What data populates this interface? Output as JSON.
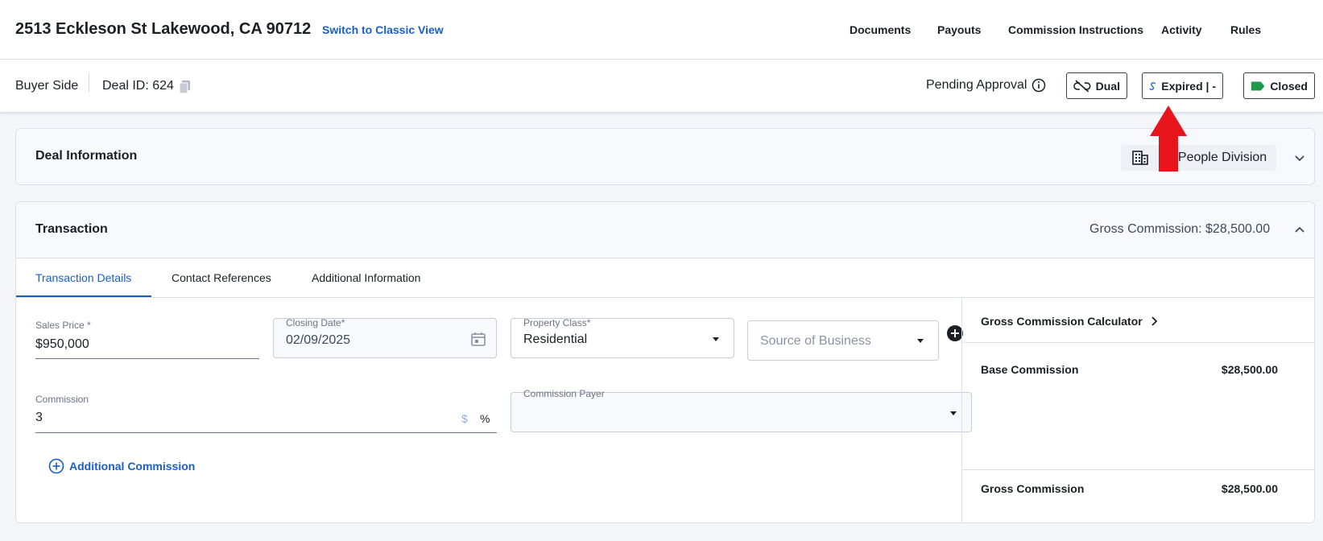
{
  "header": {
    "title": "2513 Eckleson St Lakewood, CA 90712",
    "classic_link": "Switch to Classic View",
    "nav": [
      "Documents",
      "Payouts",
      "Commission Instructions",
      "Activity",
      "Rules"
    ]
  },
  "subheader": {
    "side": "Buyer Side",
    "deal_id": "Deal ID: 624",
    "status": "Pending Approval",
    "chips": {
      "dual": "Dual",
      "expired": "Expired | -",
      "closed": "Closed"
    }
  },
  "deal_info": {
    "title": "Deal Information",
    "division": "No People Division"
  },
  "transaction": {
    "title": "Transaction",
    "gross_header": "Gross Commission: $28,500.00",
    "tabs": [
      "Transaction Details",
      "Contact References",
      "Additional Information"
    ],
    "fields": {
      "sales_price_label": "Sales Price *",
      "sales_price": "$950,000",
      "closing_date_label": "Closing Date*",
      "closing_date": "02/09/2025",
      "property_class_label": "Property Class*",
      "property_class": "Residential",
      "source_placeholder": "Source of Business",
      "commission_label": "Commission",
      "commission": "3",
      "dollar": "$",
      "percent": "%",
      "payer_label": "Commission Payer"
    },
    "additional_commission": "Additional Commission",
    "calculator": {
      "title": "Gross Commission Calculator",
      "base_label": "Base Commission",
      "base_value": "$28,500.00",
      "gross_label": "Gross Commission",
      "gross_value": "$28,500.00"
    }
  },
  "colors": {
    "accent": "#1a5fc9",
    "closed_tag": "#1f9a4a",
    "annotation_arrow": "#e8141c"
  }
}
